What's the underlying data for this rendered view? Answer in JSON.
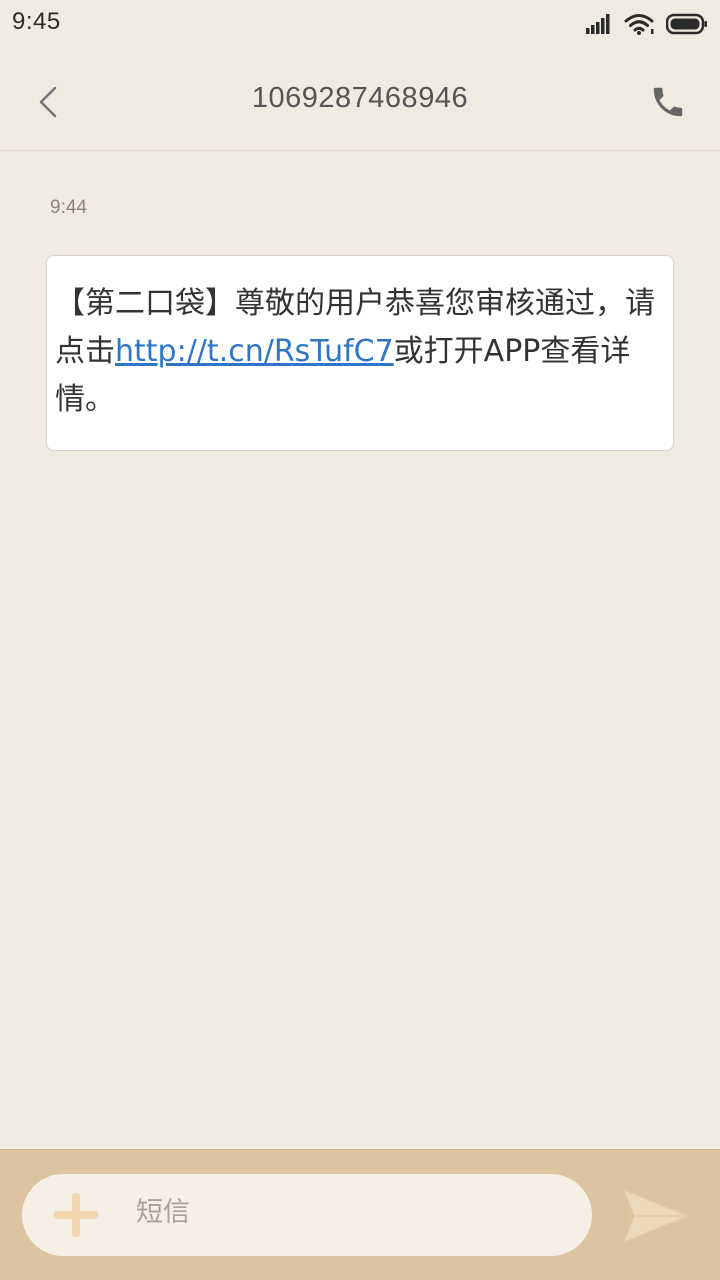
{
  "status_bar": {
    "time": "9:45",
    "icons": [
      "signal-icon",
      "wifi-icon",
      "battery-icon"
    ]
  },
  "header": {
    "title": "1069287468946",
    "back_icon": "back-chevron-icon",
    "call_icon": "phone-icon"
  },
  "conversation": {
    "timestamp": "9:44",
    "message": {
      "text_before_link": "【第二口袋】尊敬的用户恭喜您审核通过，请点击",
      "link": "http://t.cn/RsTufC7",
      "text_after_link": "或打开APP查看详情。"
    }
  },
  "input_bar": {
    "placeholder": "短信",
    "add_icon": "plus-icon",
    "send_icon": "send-icon"
  },
  "colors": {
    "background": "#f0ebe1",
    "bubble": "#ffffff",
    "link": "#2f76c9",
    "input_bar": "#dcc4a0",
    "accent": "#f3d7b3"
  }
}
